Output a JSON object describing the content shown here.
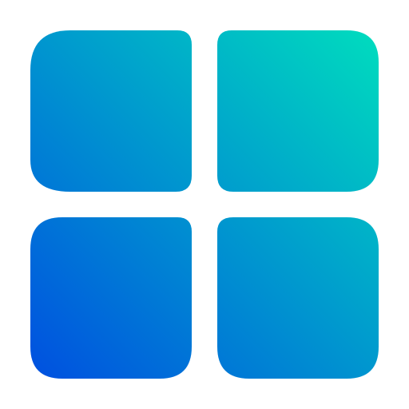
{
  "icon": {
    "name": "grid-app-icon",
    "colors": {
      "gradient_start": "#0050e0",
      "gradient_end": "#00dcbe",
      "background": "#ffffff"
    }
  }
}
